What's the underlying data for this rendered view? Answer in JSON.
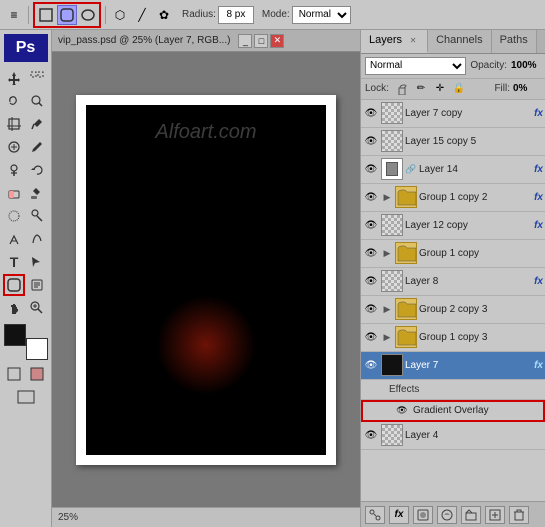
{
  "toolbar": {
    "radius_label": "Radius:",
    "radius_value": "8 px",
    "mode_label": "Mode:",
    "mode_value": "Normal"
  },
  "doc_tab": {
    "label": "vip_pass.psd @ 25% (Layer 7, RGB...)"
  },
  "canvas": {
    "watermark": "Alfoart.com",
    "zoom": "25%"
  },
  "panels": {
    "layers_tab": "Layers",
    "channels_tab": "Channels",
    "paths_tab": "Paths"
  },
  "layers_panel": {
    "blend_mode": "Normal",
    "opacity_label": "Opacity:",
    "opacity_value": "100%",
    "lock_label": "Lock:",
    "fill_label": "Fill:",
    "fill_value": "0%"
  },
  "layers": [
    {
      "id": 1,
      "name": "Layer 7 copy",
      "visible": true,
      "fx": true,
      "has_thumb": true,
      "thumb_type": "checker",
      "indent": 0,
      "active": false
    },
    {
      "id": 2,
      "name": "Layer 15 copy 5",
      "visible": true,
      "fx": false,
      "has_thumb": true,
      "thumb_type": "checker",
      "indent": 0,
      "active": false
    },
    {
      "id": 3,
      "name": "Layer 14",
      "visible": true,
      "fx": true,
      "has_thumb": true,
      "thumb_type": "white_rect",
      "indent": 0,
      "active": false,
      "has_link": true
    },
    {
      "id": 4,
      "name": "Group 1 copy 2",
      "visible": true,
      "fx": true,
      "has_thumb": false,
      "thumb_type": "folder",
      "indent": 0,
      "active": false
    },
    {
      "id": 5,
      "name": "Layer 12 copy",
      "visible": true,
      "fx": true,
      "has_thumb": true,
      "thumb_type": "checker",
      "indent": 0,
      "active": false
    },
    {
      "id": 6,
      "name": "Group 1 copy",
      "visible": true,
      "fx": false,
      "has_thumb": false,
      "thumb_type": "folder",
      "indent": 0,
      "active": false
    },
    {
      "id": 7,
      "name": "Layer 8",
      "visible": true,
      "fx": true,
      "has_thumb": true,
      "thumb_type": "checker",
      "indent": 0,
      "active": false
    },
    {
      "id": 8,
      "name": "Group 2 copy 3",
      "visible": true,
      "fx": false,
      "has_thumb": false,
      "thumb_type": "folder",
      "indent": 0,
      "active": false
    },
    {
      "id": 9,
      "name": "Group 1 copy 3",
      "visible": true,
      "fx": false,
      "has_thumb": false,
      "thumb_type": "folder",
      "indent": 0,
      "active": false
    },
    {
      "id": 10,
      "name": "Layer 7",
      "visible": true,
      "fx": true,
      "has_thumb": true,
      "thumb_type": "dark",
      "indent": 0,
      "active": true
    },
    {
      "id": 11,
      "name": "Effects",
      "visible": false,
      "fx": false,
      "has_thumb": false,
      "thumb_type": "effects",
      "indent": 1,
      "active": false
    },
    {
      "id": 12,
      "name": "Gradient Overlay",
      "visible": true,
      "fx": false,
      "has_thumb": false,
      "thumb_type": "gradient_overlay",
      "indent": 2,
      "active": false
    },
    {
      "id": 13,
      "name": "Layer 4",
      "visible": true,
      "fx": false,
      "has_thumb": true,
      "thumb_type": "checker",
      "indent": 0,
      "active": false
    }
  ],
  "footer_buttons": [
    "new_group",
    "new_layer",
    "delete_layer"
  ]
}
